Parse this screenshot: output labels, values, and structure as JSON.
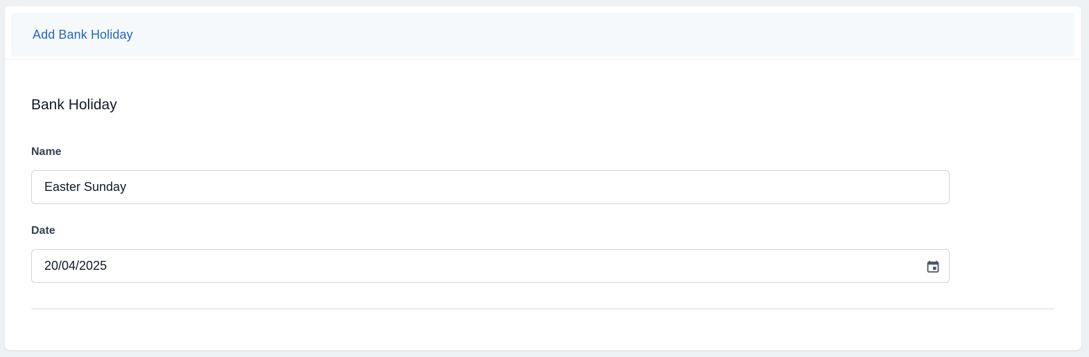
{
  "header": {
    "title": "Add Bank Holiday"
  },
  "form": {
    "section_title": "Bank Holiday",
    "name": {
      "label": "Name",
      "value": "Easter Sunday"
    },
    "date": {
      "label": "Date",
      "value": "20/04/2025",
      "icon": "calendar-icon"
    }
  },
  "colors": {
    "accent": "#2466c1",
    "header_bg": "#f5f9fc",
    "page_bg": "#eef1f4",
    "border": "#cfd4da",
    "label": "#344054",
    "icon": "#4b5563"
  }
}
